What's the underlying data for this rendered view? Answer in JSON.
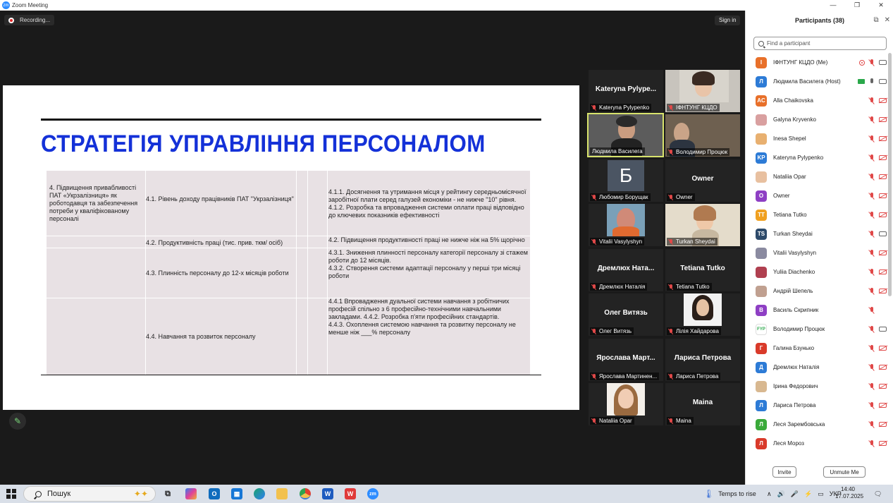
{
  "window": {
    "title": "Zoom Meeting",
    "app_icon": "zm"
  },
  "topbar": {
    "recording": "Recording...",
    "signin": "Sign in"
  },
  "slide": {
    "title": "СТРАТЕГІЯ УПРАВЛІННЯ ПЕРСОНАЛОМ",
    "col1": "4. Підвищення привабливості ПАТ «Укрзалізниця» як роботодавця та забезпечення потреби у кваліфікованому персоналі",
    "rows": [
      {
        "measure": "4.1. Рівень доходу працівників ПАТ \"Укрзалізниця\"",
        "target": "4.1.1. Досягнення та утримання місця у рейтингу середньомісячної заробітної плати серед галузей економіки - не нижче \"10\" рівня. 4.1.2. Розробка та впровадження системи оплати праці відповідно до ключевих показників ефективності"
      },
      {
        "measure": "4.2. Продуктивність праці (тис. прив. ткм/ осіб)",
        "target": "4.2. Підвищення продуктивності праці не нижче ніж на 5% щорічно"
      },
      {
        "measure": "4.3. Плинність персоналу до 12-х місяців роботи",
        "target": "4.3.1. Зниження плинності персоналу категорії персоналу зі стажем роботи до 12 місяців.\n4.3.2. Створення системи адаптації персоналу у перші три місяці роботи"
      },
      {
        "measure": "4.4. Навчання та розвиток персоналу",
        "target": "4.4.1 Впровадження дуальної системи навчання з робітничих професій спільно з 6 професійно-технічними навчальними закладами.                                                  4.4.2. Розробка п'яти  професійних стандартів.\n4.4.3. Охоплення системою навчання та розвитку персоналу не менше ніж ___% персоналу"
      }
    ]
  },
  "tiles": [
    {
      "big": "Kateryna  Pylype...",
      "label": "Kateryna Pylypenko"
    },
    {
      "big": "",
      "label": "ІФНТУНГ КЦДО"
    },
    {
      "big": "",
      "label": "Людмила Василега"
    },
    {
      "big": "",
      "label": "Володимир Процюк"
    },
    {
      "big": "",
      "label": "Любомир Борущак",
      "avatar": "Б"
    },
    {
      "big": "Owner",
      "label": "Owner"
    },
    {
      "big": "",
      "label": "Vitalii Vasylyshyn"
    },
    {
      "big": "",
      "label": "Turkan Sheydai"
    },
    {
      "big": "Дремлюх  Ната...",
      "label": "Дремлюх Наталія"
    },
    {
      "big": "Tetiana Tutko",
      "label": "Tetiana Tutko"
    },
    {
      "big": "Олег Витязь",
      "label": "Олег Витязь"
    },
    {
      "big": "",
      "label": "Лілія Хайдарова"
    },
    {
      "big": "Ярослава  Март...",
      "label": "Ярослава Мартинен..."
    },
    {
      "big": "Лариса Петрова",
      "label": "Лариса Петрова"
    },
    {
      "big": "",
      "label": "Nataliia Opar"
    },
    {
      "big": "Maina",
      "label": "Maina"
    }
  ],
  "panel": {
    "title": "Participants (38)",
    "search_placeholder": "Find a participant",
    "invite": "Invite",
    "unmute": "Unmute Me",
    "participants": [
      {
        "initials": "І",
        "color": "#e8702a",
        "name": "ІФНТУНГ КЦДО (Me)"
      },
      {
        "initials": "Л",
        "color": "#2d7bd6",
        "name": "Людмила Василега (Host)"
      },
      {
        "initials": "AC",
        "color": "#e8702a",
        "name": "Alla Chaikovska"
      },
      {
        "initials": "",
        "color": "#d9a0a0",
        "name": "Galyna Kryvenko"
      },
      {
        "initials": "",
        "color": "#e8b070",
        "name": "Inesa Shepel"
      },
      {
        "initials": "KP",
        "color": "#2d7bd6",
        "name": "Kateryna Pylypenko"
      },
      {
        "initials": "",
        "color": "#e8c0a0",
        "name": "Nataliia Opar"
      },
      {
        "initials": "O",
        "color": "#8e3fc4",
        "name": "Owner"
      },
      {
        "initials": "TT",
        "color": "#f0a020",
        "name": "Tetiana Tutko"
      },
      {
        "initials": "TS",
        "color": "#2d4a6a",
        "name": "Turkan Sheydai"
      },
      {
        "initials": "",
        "color": "#8a8aa0",
        "name": "Vitalii Vasylyshyn"
      },
      {
        "initials": "",
        "color": "#b04050",
        "name": "Yuliia Diachenko"
      },
      {
        "initials": "",
        "color": "#c0a090",
        "name": "Андрій Шепель"
      },
      {
        "initials": "В",
        "color": "#8e3fc4",
        "name": "Василь Скрипник"
      },
      {
        "initials": "FYP",
        "color": "#ffffff",
        "name": "Володимир Процюк"
      },
      {
        "initials": "Г",
        "color": "#d93a2a",
        "name": "Галина Бзунько"
      },
      {
        "initials": "Д",
        "color": "#2d7bd6",
        "name": "Дремлюх Наталія"
      },
      {
        "initials": "",
        "color": "#d8b890",
        "name": "Ірина Федорович"
      },
      {
        "initials": "Л",
        "color": "#2d7bd6",
        "name": "Лариса Петрова"
      },
      {
        "initials": "Л",
        "color": "#3aaa3a",
        "name": "Леся Зарембовська"
      },
      {
        "initials": "Л",
        "color": "#d93a2a",
        "name": "Леся Мороз"
      }
    ]
  },
  "taskbar": {
    "search": "Пошук",
    "weather": "Temps to rise",
    "lang": "УКР",
    "time": "14:40",
    "date": "17.07.2025"
  }
}
